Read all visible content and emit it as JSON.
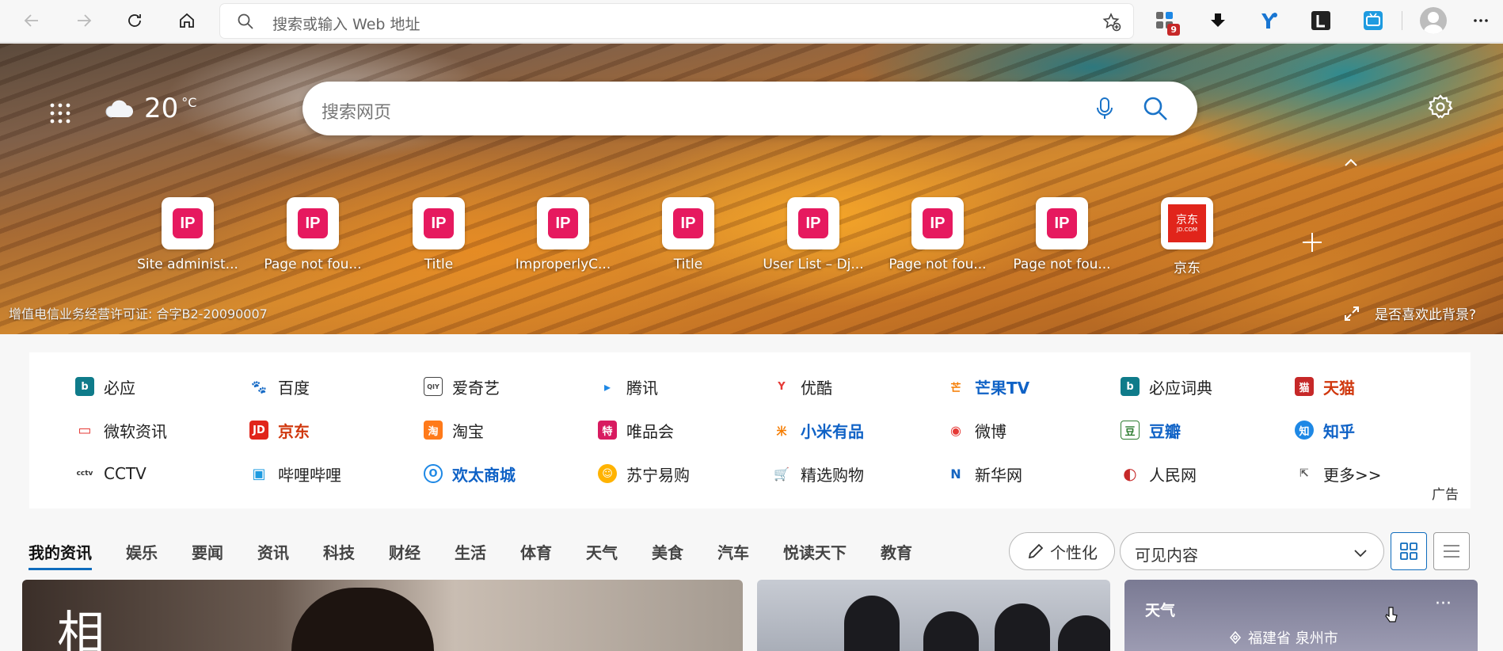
{
  "toolbar": {
    "address_placeholder": "搜索或输入 Web 地址",
    "extensions_badge": "9"
  },
  "hero": {
    "temperature": "20",
    "temperature_unit": "°C",
    "search_placeholder": "搜索网页",
    "tiles": [
      {
        "label": "Site administ...",
        "icon": "IP"
      },
      {
        "label": "Page not fou...",
        "icon": "IP"
      },
      {
        "label": "Title",
        "icon": "IP"
      },
      {
        "label": "ImproperlyC...",
        "icon": "IP"
      },
      {
        "label": "Title",
        "icon": "IP"
      },
      {
        "label": "User List – Dj...",
        "icon": "IP"
      },
      {
        "label": "Page not fou...",
        "icon": "IP"
      },
      {
        "label": "Page not fou...",
        "icon": "IP"
      },
      {
        "label": "京东",
        "icon_line1": "京东",
        "icon_line2": "JD.COM"
      }
    ],
    "license": "增值电信业务经营许可证: 合字B2-20090007",
    "like_background": "是否喜欢此背景?"
  },
  "links": {
    "rows": [
      [
        "必应",
        "百度",
        "爱奇艺",
        "腾讯",
        "优酷",
        "芒果TV",
        "必应词典",
        "天猫"
      ],
      [
        "微软资讯",
        "京东",
        "淘宝",
        "唯品会",
        "小米有品",
        "微博",
        "豆瓣",
        "知乎"
      ],
      [
        "CCTV",
        "哔哩哔哩",
        "欢太商城",
        "苏宁易购",
        "精选购物",
        "新华网",
        "人民网",
        "更多>>"
      ]
    ],
    "icon_glyphs": [
      [
        "b",
        "🐾",
        "QIY",
        "▸",
        "Y",
        "芒",
        "b",
        "猫"
      ],
      [
        "▭",
        "JD",
        "淘",
        "特",
        "米",
        "◉",
        "豆",
        "知"
      ],
      [
        "cctv",
        "▣",
        "O",
        "☺",
        "🛒",
        "N",
        "◐",
        "⇱"
      ]
    ],
    "ad_label": "广告"
  },
  "feed": {
    "tabs": [
      "我的资讯",
      "娱乐",
      "要闻",
      "资讯",
      "科技",
      "财经",
      "生活",
      "体育",
      "天气",
      "美食",
      "汽车",
      "悦读天下",
      "教育"
    ],
    "personalize": "个性化",
    "visible_content": "可见内容",
    "card1_glyph": "相",
    "weather_title": "天气",
    "weather_more": "···",
    "weather_location": "福建省 泉州市"
  }
}
